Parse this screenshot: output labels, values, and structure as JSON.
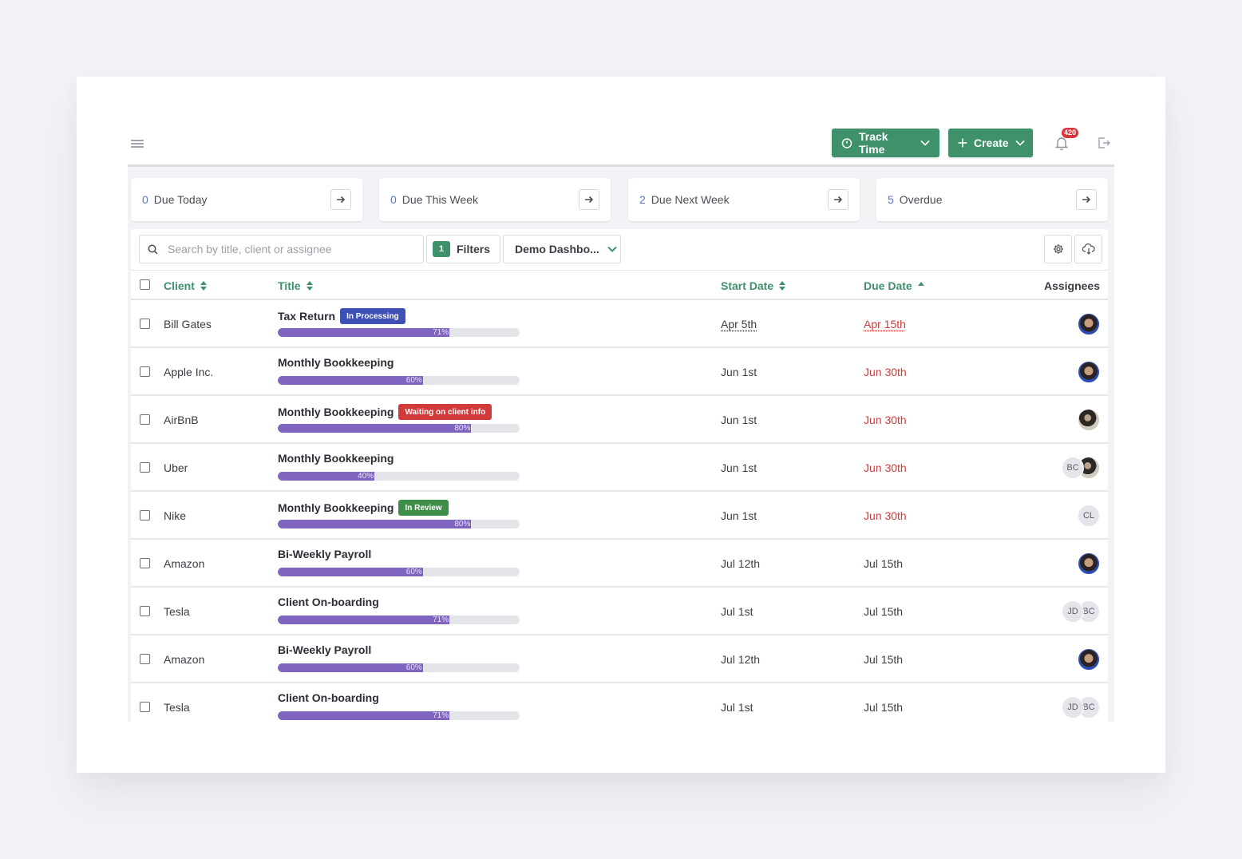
{
  "topbar": {
    "menu_icon": "hamburger-icon",
    "track_time": {
      "label": "Track Time",
      "icon": "stopwatch-icon"
    },
    "create": {
      "label": "Create",
      "icon": "plus-icon"
    },
    "notifications": {
      "count": "420",
      "icon": "bell-icon"
    },
    "logout_icon": "logout-icon"
  },
  "summary_cards": [
    {
      "count": "0",
      "label": "Due Today"
    },
    {
      "count": "0",
      "label": "Due This Week"
    },
    {
      "count": "2",
      "label": "Due Next Week"
    },
    {
      "count": "5",
      "label": "Overdue"
    }
  ],
  "toolbar": {
    "search_placeholder": "Search by title, client or assignee",
    "search_value": "",
    "filters_count": "1",
    "filters_label": "Filters",
    "dashboard_select": "Demo Dashbo...",
    "settings_icon": "gear-icon",
    "export_icon": "cloud-download-icon"
  },
  "columns": {
    "client": "Client",
    "title": "Title",
    "start_date": "Start Date",
    "due_date": "Due Date",
    "assignees": "Assignees"
  },
  "colors": {
    "primary_green": "#3e916a",
    "progress_purple": "#7f65bf",
    "overdue_red": "#d23a3a",
    "count_blue": "#5a78c8"
  },
  "rows": [
    {
      "client": "Bill Gates",
      "title": "Tax Return",
      "badge": {
        "text": "In Processing",
        "color": "#3f51b5"
      },
      "progress": 71,
      "progress_label": "71%",
      "start": "Apr 5th",
      "due": "Apr 15th",
      "due_late": true,
      "dotted": true,
      "assignees": [
        {
          "type": "photo-a"
        }
      ]
    },
    {
      "client": "Apple Inc.",
      "title": "Monthly Bookkeeping",
      "badge": null,
      "progress": 60,
      "progress_label": "60%",
      "start": "Jun 1st",
      "due": "Jun 30th",
      "due_late": true,
      "dotted": false,
      "assignees": [
        {
          "type": "photo-a"
        }
      ]
    },
    {
      "client": "AirBnB",
      "title": "Monthly Bookkeeping",
      "badge": {
        "text": "Waiting on client info",
        "color": "#d23a3a"
      },
      "progress": 80,
      "progress_label": "80%",
      "start": "Jun 1st",
      "due": "Jun 30th",
      "due_late": true,
      "dotted": false,
      "assignees": [
        {
          "type": "photo-b"
        }
      ]
    },
    {
      "client": "Uber",
      "title": "Monthly Bookkeeping",
      "badge": null,
      "progress": 40,
      "progress_label": "40%",
      "start": "Jun 1st",
      "due": "Jun 30th",
      "due_late": true,
      "dotted": false,
      "assignees": [
        {
          "type": "initials",
          "text": "BC"
        },
        {
          "type": "photo-b"
        }
      ]
    },
    {
      "client": "Nike",
      "title": "Monthly Bookkeeping",
      "badge": {
        "text": "In Review",
        "color": "#3e8e4a"
      },
      "progress": 80,
      "progress_label": "80%",
      "start": "Jun 1st",
      "due": "Jun 30th",
      "due_late": true,
      "dotted": false,
      "assignees": [
        {
          "type": "initials",
          "text": "CL"
        }
      ]
    },
    {
      "client": "Amazon",
      "title": "Bi-Weekly Payroll",
      "badge": null,
      "progress": 60,
      "progress_label": "60%",
      "start": "Jul 12th",
      "due": "Jul 15th",
      "due_late": false,
      "dotted": false,
      "assignees": [
        {
          "type": "photo-a"
        }
      ]
    },
    {
      "client": "Tesla",
      "title": "Client On-boarding",
      "badge": null,
      "progress": 71,
      "progress_label": "71%",
      "start": "Jul 1st",
      "due": "Jul 15th",
      "due_late": false,
      "dotted": false,
      "assignees": [
        {
          "type": "initials",
          "text": "JD"
        },
        {
          "type": "initials",
          "text": "BC"
        }
      ]
    },
    {
      "client": "Amazon",
      "title": "Bi-Weekly Payroll",
      "badge": null,
      "progress": 60,
      "progress_label": "60%",
      "start": "Jul 12th",
      "due": "Jul 15th",
      "due_late": false,
      "dotted": false,
      "assignees": [
        {
          "type": "photo-a"
        }
      ]
    },
    {
      "client": "Tesla",
      "title": "Client On-boarding",
      "badge": null,
      "progress": 71,
      "progress_label": "71%",
      "start": "Jul 1st",
      "due": "Jul 15th",
      "due_late": false,
      "dotted": false,
      "assignees": [
        {
          "type": "initials",
          "text": "JD"
        },
        {
          "type": "initials",
          "text": "BC"
        }
      ]
    }
  ]
}
